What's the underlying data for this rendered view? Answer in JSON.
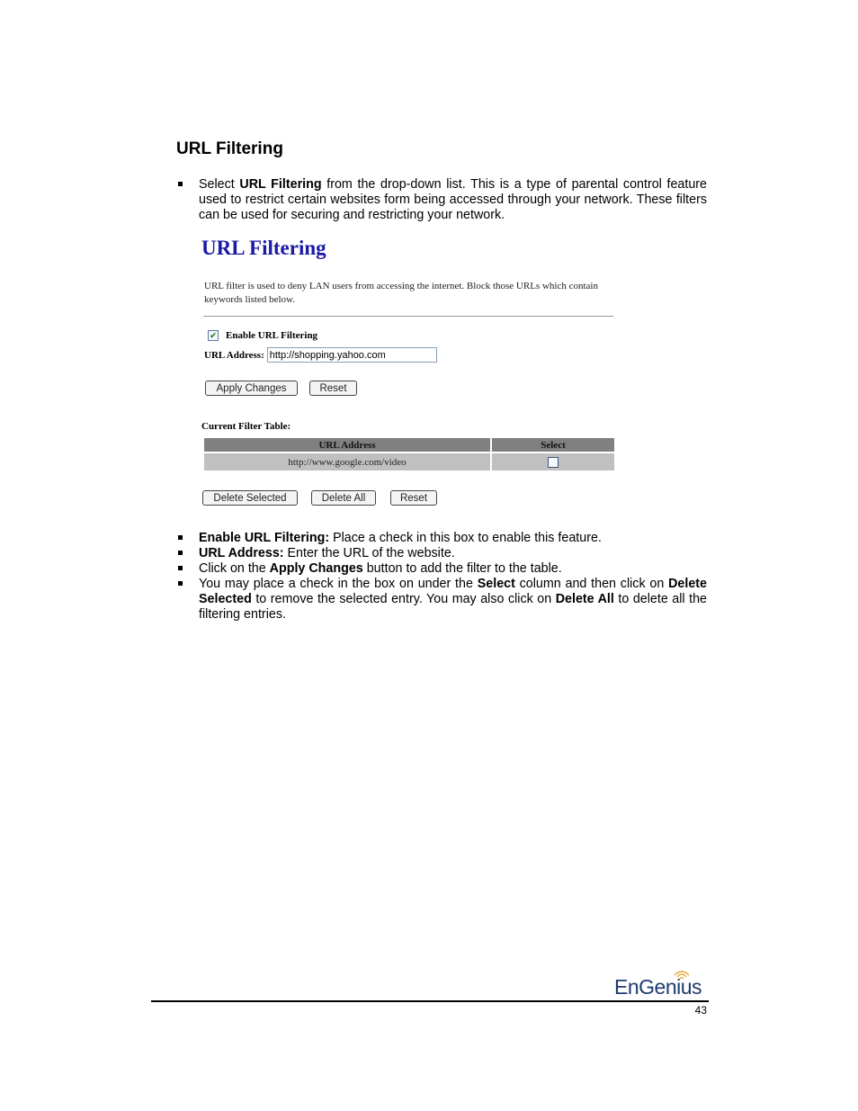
{
  "section_title": "URL Filtering",
  "intro": {
    "segments": [
      "Select ",
      "URL Filtering",
      " from the drop-down list. This is a type of parental control feature used to restrict certain websites form being accessed through your network. These filters can be used for securing and restricting your network."
    ]
  },
  "screenshot": {
    "title": "URL Filtering",
    "description": "URL filter is used to deny LAN users from accessing the internet. Block those URLs which contain keywords listed below.",
    "enable_checkbox": {
      "label": "Enable URL Filtering",
      "checked": true,
      "check_glyph": "✔"
    },
    "url_field": {
      "label": "URL Address:",
      "value": "http://shopping.yahoo.com"
    },
    "buttons": {
      "apply": "Apply Changes",
      "reset": "Reset",
      "delete_selected": "Delete Selected",
      "delete_all": "Delete All",
      "reset_2": "Reset"
    },
    "table": {
      "label": "Current Filter Table:",
      "columns": [
        "URL Address",
        "Select"
      ],
      "rows": [
        {
          "url": "http://www.google.com/video",
          "selected": false
        }
      ]
    }
  },
  "details": [
    {
      "bold": "Enable URL Filtering:",
      "text": " Place a check in this box to enable this feature."
    },
    {
      "bold": "URL Address:",
      "text": " Enter the URL of the website."
    },
    {
      "pre": "Click on the ",
      "bold": "Apply Changes",
      "text": " button to add the filter to the table."
    },
    {
      "pre": "You may place a check in the box on under the ",
      "bold": "Select",
      "mid": " column and then click on ",
      "bold2": "Delete Selected",
      "mid2": " to remove the selected entry. You may also click on ",
      "bold3": "Delete All",
      "text": " to delete all the filtering entries."
    }
  ],
  "footer": {
    "logo_text": "EnGenius",
    "logo_icon": "wifi-signal-icon",
    "brand_color": "#1f3c6e",
    "accent_color": "#e0a020",
    "page_number": "43"
  }
}
